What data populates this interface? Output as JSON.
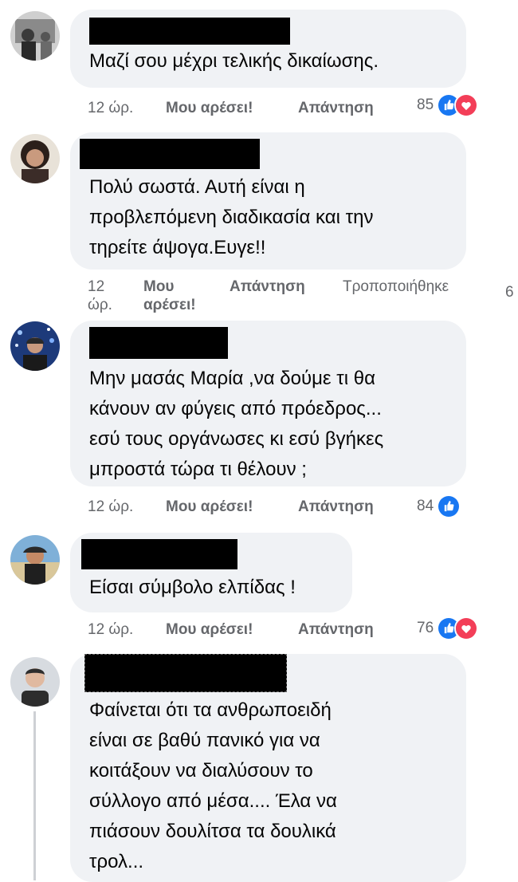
{
  "comments": [
    {
      "text": "Μαζί σου μέχρι τελικής δικαίωσης.",
      "time": "12 ώρ.",
      "like": "Μου αρέσει!",
      "reply": "Απάντηση",
      "reactions": "85",
      "icons": [
        "like-icon",
        "love-icon"
      ]
    },
    {
      "text": "Πολύ σωστά. Αυτή είναι η\nπροβλεπόμενη διαδικασία και την\nτηρείτε άψογα.Ευγε!!",
      "time": "12\nώρ.",
      "like": "Μου\nαρέσει!",
      "reply": "Απάντηση",
      "edited": "Τροποποιήθηκε",
      "reactions": "6"
    },
    {
      "text": "Μην μασάς Μαρία ,να δούμε τι θα\nκάνουν αν φύγεις από πρόεδρος...\nεσύ τους οργάνωσες κι εσύ βγήκες\nμπροστά τώρα τι θέλουν ;",
      "time": "12 ώρ.",
      "like": "Μου αρέσει!",
      "reply": "Απάντηση",
      "reactions": "84",
      "icons": [
        "like-icon"
      ]
    },
    {
      "text": "Είσαι σύμβολο ελπίδας !",
      "time": "12 ώρ.",
      "like": "Μου αρέσει!",
      "reply": "Απάντηση",
      "reactions": "76",
      "icons": [
        "like-icon",
        "love-icon"
      ]
    },
    {
      "text": "Φαίνεται ότι τα ανθρωποειδή\nείναι σε βαθύ πανικό για να\nκοιτάξουν να διαλύσουν το\nσύλλογο από μέσα.... Έλα να\nπιάσουν δουλίτσα τα δουλικά\nτρολ..."
    }
  ],
  "colors": {
    "bubble": "#f0f2f5",
    "meta": "#65676b",
    "like_blue": "#1877f2",
    "love_red": "#f33e58"
  }
}
